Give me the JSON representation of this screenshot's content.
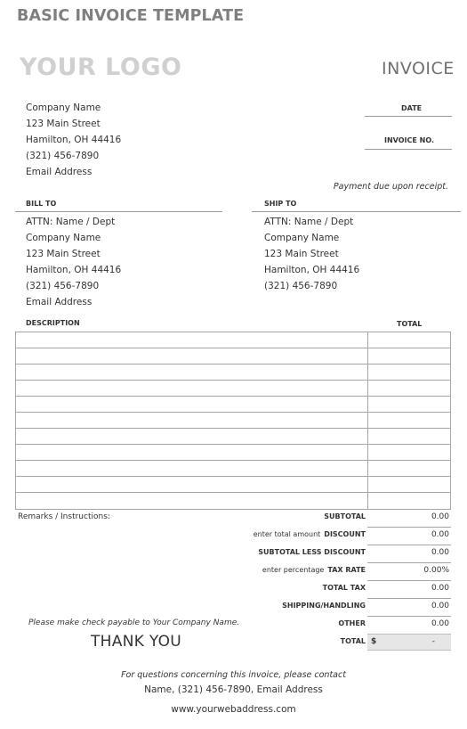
{
  "document": {
    "title": "BASIC INVOICE TEMPLATE",
    "logo_placeholder": "YOUR LOGO",
    "invoice_heading": "INVOICE"
  },
  "company": {
    "lines": [
      "Company Name",
      "123 Main Street",
      "Hamilton, OH  44416",
      "(321) 456-7890",
      "Email Address"
    ]
  },
  "meta": {
    "date_label": "DATE",
    "date_value": "",
    "invoice_no_label": "INVOICE NO.",
    "invoice_no_value": "",
    "payment_note": "Payment due upon receipt."
  },
  "bill_to": {
    "label": "BILL TO",
    "lines": [
      "ATTN: Name / Dept",
      "Company Name",
      "123 Main Street",
      "Hamilton, OH  44416",
      "(321) 456-7890",
      "Email Address"
    ]
  },
  "ship_to": {
    "label": "SHIP TO",
    "lines": [
      "ATTN: Name / Dept",
      "Company Name",
      "123 Main Street",
      "Hamilton, OH  44416",
      "(321) 456-7890"
    ]
  },
  "items": {
    "headers": {
      "description": "DESCRIPTION",
      "total": "TOTAL"
    },
    "rows": [
      {
        "description": "",
        "total": ""
      },
      {
        "description": "",
        "total": ""
      },
      {
        "description": "",
        "total": ""
      },
      {
        "description": "",
        "total": ""
      },
      {
        "description": "",
        "total": ""
      },
      {
        "description": "",
        "total": ""
      },
      {
        "description": "",
        "total": ""
      },
      {
        "description": "",
        "total": ""
      },
      {
        "description": "",
        "total": ""
      },
      {
        "description": "",
        "total": ""
      },
      {
        "description": "",
        "total": ""
      }
    ]
  },
  "remarks_label": "Remarks / Instructions:",
  "totals": {
    "rows": [
      {
        "hint": "",
        "label": "SUBTOTAL",
        "value": "0.00"
      },
      {
        "hint": "enter total amount",
        "label": "DISCOUNT",
        "value": "0.00"
      },
      {
        "hint": "",
        "label": "SUBTOTAL LESS DISCOUNT",
        "value": "0.00"
      },
      {
        "hint": "enter percentage",
        "label": "TAX RATE",
        "value": "0.00%"
      },
      {
        "hint": "",
        "label": "TOTAL TAX",
        "value": "0.00"
      },
      {
        "hint": "",
        "label": "SHIPPING/HANDLING",
        "value": "0.00"
      },
      {
        "hint": "",
        "label": "OTHER",
        "value": "0.00"
      }
    ],
    "grand_total": {
      "label": "TOTAL",
      "currency": "$",
      "value": "-"
    },
    "grand_total_bg": "#e6e6e6"
  },
  "check_note": "Please make check payable to Your Company Name.",
  "thank_you": "THANK YOU",
  "footer": {
    "question_line": "For questions concerning this invoice, please contact",
    "contact_line": "Name, (321) 456-7890, Email Address",
    "website": "www.yourwebaddress.com"
  }
}
